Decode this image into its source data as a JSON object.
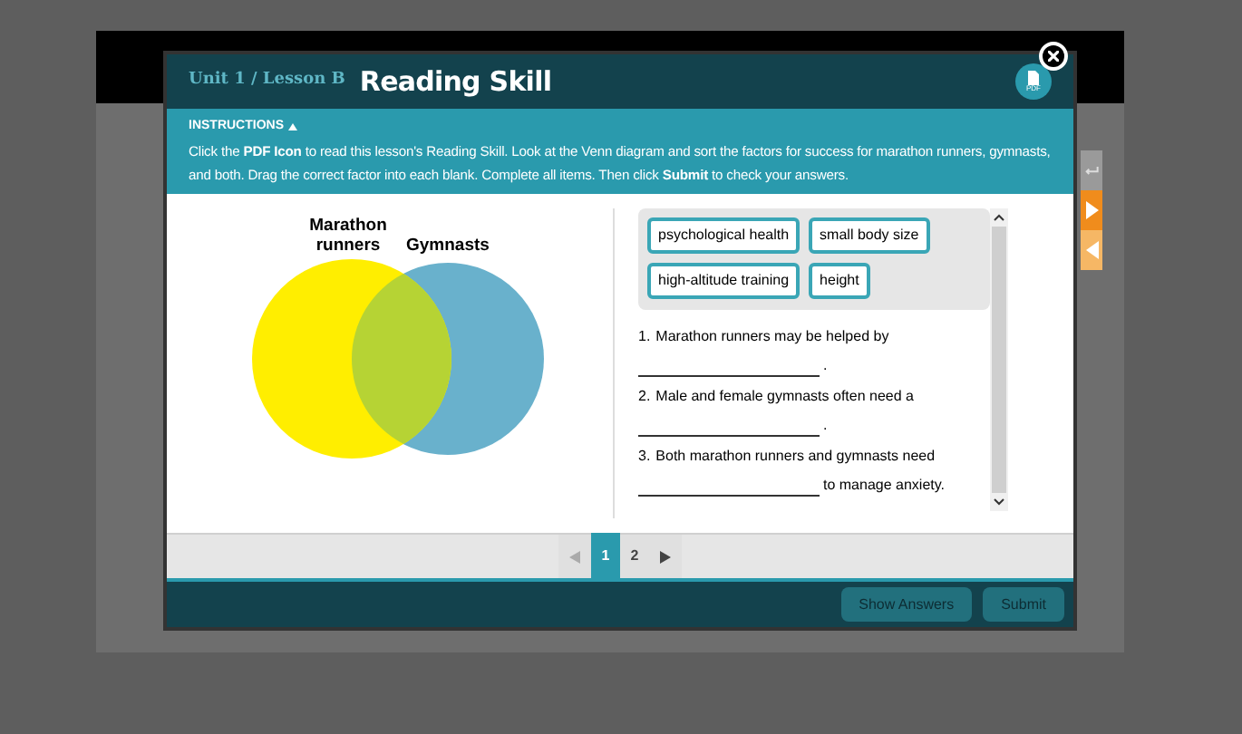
{
  "header": {
    "unit": "Unit 1 / Lesson B",
    "title": "Reading Skill",
    "pdf_label": "PDF"
  },
  "instructions": {
    "heading": "INSTRUCTIONS",
    "expanded": true,
    "text": "Click the **PDF Icon** to read this lesson's Reading Skill. Look at the Venn diagram and sort the factors for success for marathon runners, gymnasts, and both. Drag the correct factor into each blank. Complete all items. Then click **Submit** to check your answers."
  },
  "venn": {
    "left_label": "Marathon runners",
    "right_label": "Gymnasts"
  },
  "factors": [
    "psychological health",
    "small body size",
    "high-altitude training",
    "height"
  ],
  "items": [
    {
      "number": "1.",
      "text": "Marathon runners may be helped by",
      "after": "."
    },
    {
      "number": "2.",
      "text": "Male and female gymnasts often need a",
      "after": "."
    },
    {
      "number": "3.",
      "text": "Both marathon runners and gymnasts need",
      "after": "to manage anxiety."
    }
  ],
  "pages": [
    {
      "label": "1",
      "selected": true
    },
    {
      "label": "2",
      "selected": false
    }
  ],
  "buttons": [
    "Show Answers",
    "Submit"
  ]
}
